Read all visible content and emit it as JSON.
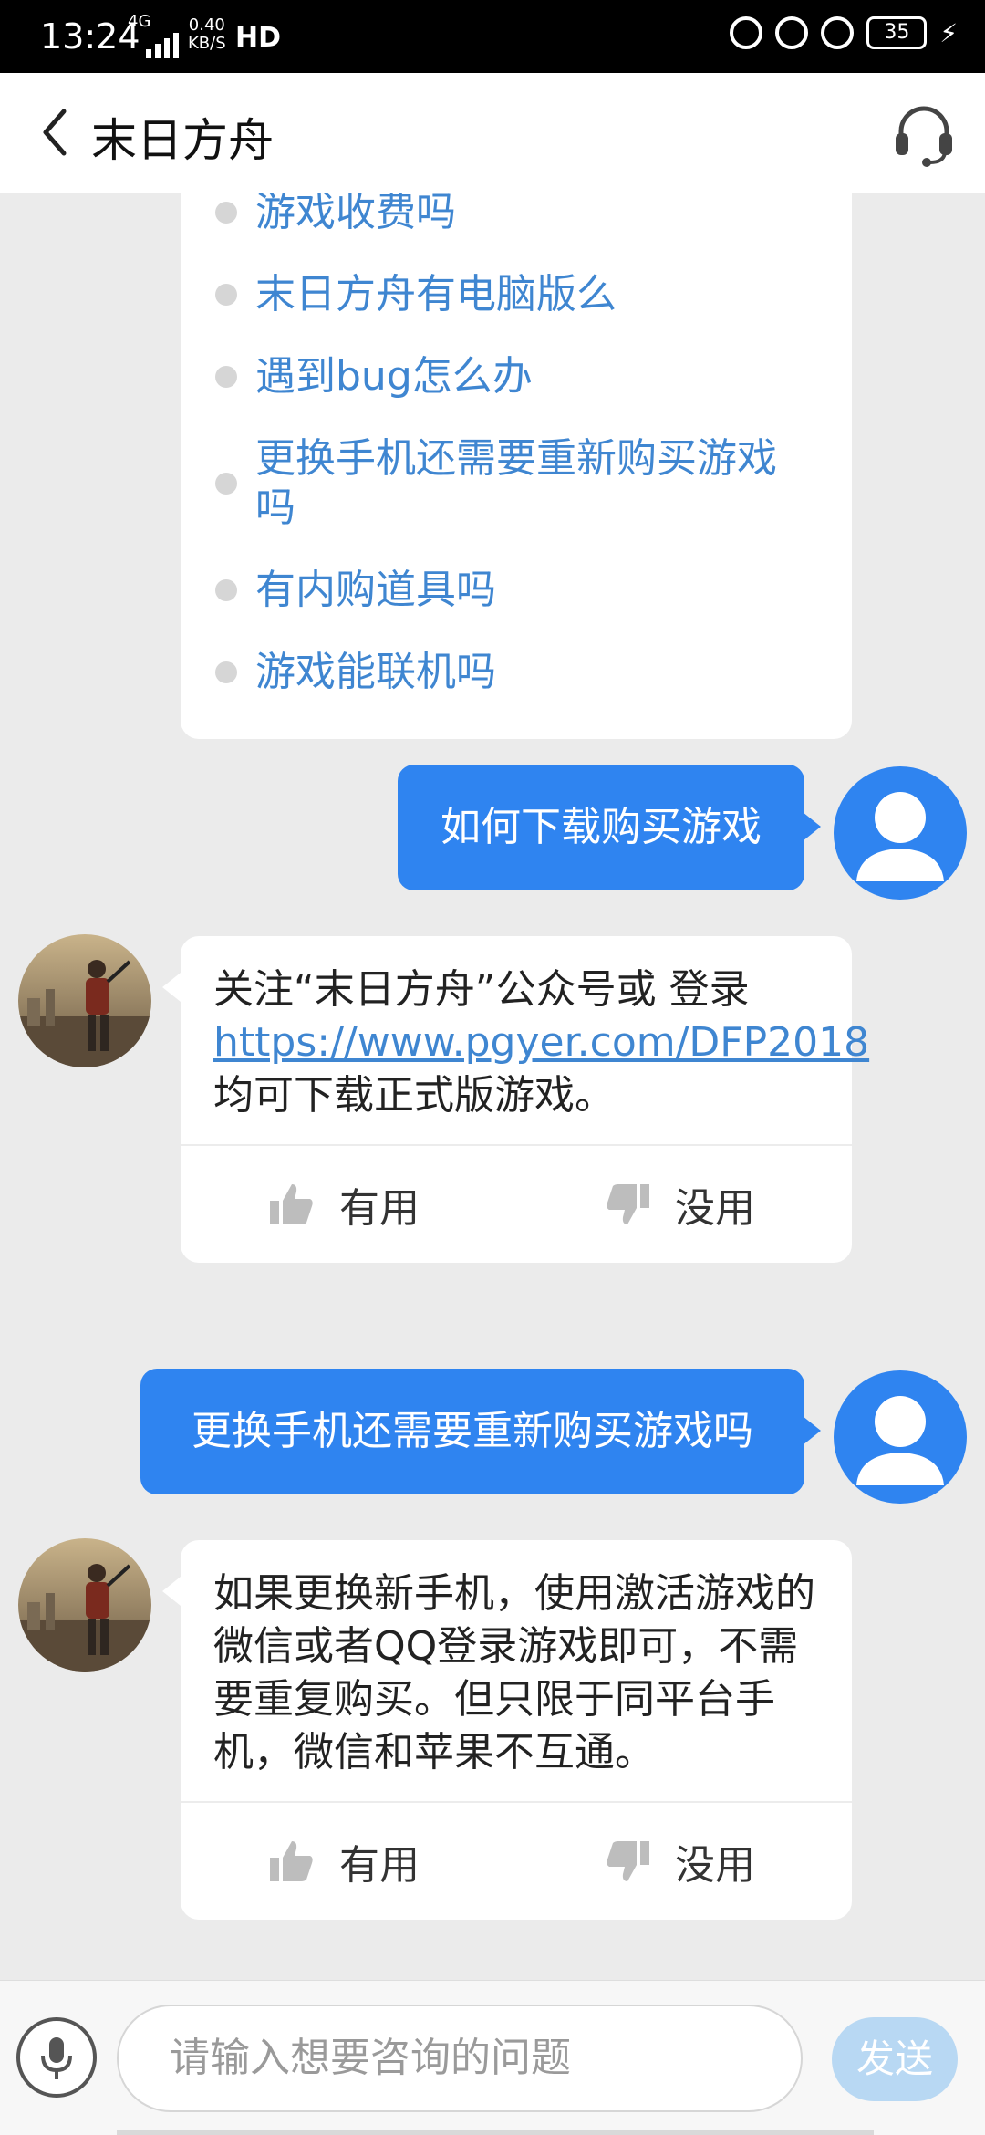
{
  "status_bar": {
    "time": "13:24",
    "network": "4G",
    "speed_value": "0.40",
    "speed_unit": "KB/S",
    "hd": "HD",
    "battery": "35"
  },
  "header": {
    "title": "末日方舟"
  },
  "faq": {
    "items": [
      "游戏收费吗",
      "末日方舟有电脑版么",
      "遇到bug怎么办",
      "更换手机还需要重新购买游戏吗",
      "有内购道具吗",
      "游戏能联机吗"
    ]
  },
  "messages": [
    {
      "from": "user",
      "text": "如何下载购买游戏"
    },
    {
      "from": "bot",
      "text_before": "关注“末日方舟”公众号或 登录 ",
      "link": "https://www.pgyer.com/DFP2018",
      "text_after": " 均可下载正式版游戏。",
      "useful_label": "有用",
      "useless_label": "没用"
    },
    {
      "from": "user",
      "text": "更换手机还需要重新购买游戏吗"
    },
    {
      "from": "bot",
      "text": "如果更换新手机，使用激活游戏的微信或者QQ登录游戏即可，不需要重复购买。但只限于同平台手机，微信和苹果不互通。",
      "useful_label": "有用",
      "useless_label": "没用"
    }
  ],
  "input": {
    "placeholder": "请输入想要咨询的问题",
    "send_label": "发送"
  },
  "colors": {
    "accent": "#2f84f0",
    "link": "#3f86d1",
    "background": "#ebebeb",
    "send_disabled": "#b8d8f3"
  }
}
